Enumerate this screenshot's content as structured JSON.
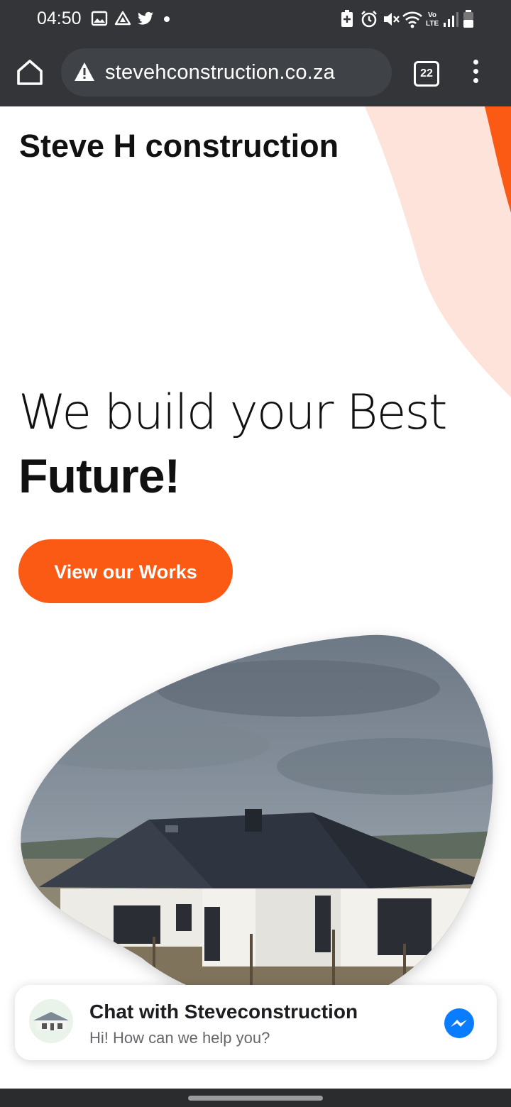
{
  "status_bar": {
    "time": "04:50",
    "left_icons": [
      "gallery-icon",
      "drive-icon",
      "twitter-icon",
      "dot-icon"
    ],
    "right_icons": [
      "battery-saver-icon",
      "alarm-icon",
      "mute-icon",
      "wifi-icon",
      "volte-icon",
      "signal-icon",
      "battery-icon"
    ]
  },
  "browser": {
    "url": "stevehconstruction.co.za",
    "tab_count": "22",
    "security_icon": "warning-icon"
  },
  "page": {
    "site_title": "Steve H construction",
    "hero_line1": "We build your Best",
    "hero_line2": "Future!",
    "cta_label": "View our Works",
    "accent_color": "#fb5a14",
    "blob_color": "#fde3d9"
  },
  "chat_widget": {
    "title": "Chat with Steveconstruction",
    "subtitle": "Hi! How can we help you?",
    "icon": "messenger-icon"
  }
}
